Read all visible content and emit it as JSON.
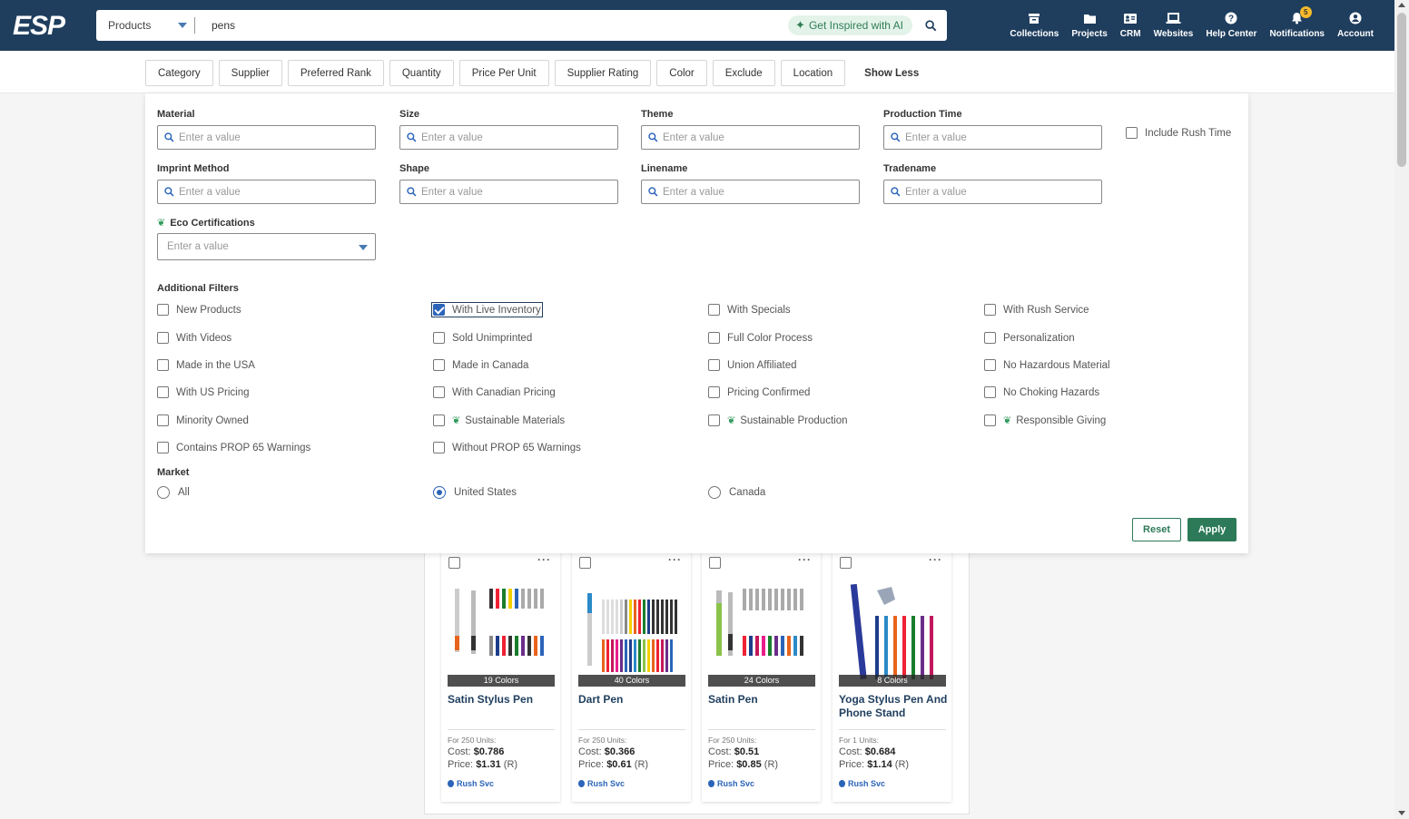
{
  "header": {
    "logo": "ESP",
    "search_scope": "Products",
    "search_value": "pens",
    "ai_label": "Get Inspired with AI",
    "nav": [
      {
        "label": "Collections",
        "icon": "collections-icon"
      },
      {
        "label": "Projects",
        "icon": "folder-icon"
      },
      {
        "label": "CRM",
        "icon": "contact-card-icon"
      },
      {
        "label": "Websites",
        "icon": "laptop-icon"
      },
      {
        "label": "Help Center",
        "icon": "help-icon"
      },
      {
        "label": "Notifications",
        "icon": "bell-icon",
        "badge": "5"
      },
      {
        "label": "Account",
        "icon": "account-icon"
      }
    ]
  },
  "filter_tabs": [
    "Category",
    "Supplier",
    "Preferred Rank",
    "Quantity",
    "Price Per Unit",
    "Supplier Rating",
    "Color",
    "Exclude",
    "Location"
  ],
  "show_less": "Show Less",
  "fields": {
    "material": "Material",
    "size": "Size",
    "theme": "Theme",
    "production_time": "Production Time",
    "imprint_method": "Imprint Method",
    "shape": "Shape",
    "linename": "Linename",
    "tradename": "Tradename",
    "eco_certifications": "Eco Certifications",
    "placeholder": "Enter a value",
    "include_rush": "Include Rush Time"
  },
  "additional_filters": {
    "title": "Additional Filters",
    "col1": [
      "New Products",
      "With Videos",
      "Made in the USA",
      "With US Pricing",
      "Minority Owned",
      "Contains PROP 65 Warnings"
    ],
    "col2": [
      "With Live Inventory",
      "Sold Unimprinted",
      "Made in Canada",
      "With Canadian Pricing",
      "Sustainable Materials",
      "Without PROP 65 Warnings"
    ],
    "col3": [
      "With Specials",
      "Full Color Process",
      "Union Affiliated",
      "Pricing Confirmed",
      "Sustainable Production"
    ],
    "col4": [
      "With Rush Service",
      "Personalization",
      "No Hazardous Material",
      "No Choking Hazards",
      "Responsible Giving"
    ]
  },
  "market": {
    "title": "Market",
    "options": [
      "All",
      "United States",
      "Canada"
    ],
    "selected": "United States"
  },
  "buttons": {
    "reset": "Reset",
    "apply": "Apply"
  },
  "products": [
    {
      "name": "Satin Stylus Pen",
      "colors": "19 Colors",
      "units": "For 250 Units:",
      "cost_label": "Cost:",
      "cost": "$0.786",
      "price_label": "Price:",
      "price": "$1.31",
      "price_suffix": "(R)",
      "rush": "Rush Svc"
    },
    {
      "name": "Dart Pen",
      "colors": "40 Colors",
      "units": "For 250 Units:",
      "cost_label": "Cost:",
      "cost": "$0.366",
      "price_label": "Price:",
      "price": "$0.61",
      "price_suffix": "(R)",
      "rush": "Rush Svc"
    },
    {
      "name": "Satin Pen",
      "colors": "24 Colors",
      "units": "For 250 Units:",
      "cost_label": "Cost:",
      "cost": "$0.51",
      "price_label": "Price:",
      "price": "$0.85",
      "price_suffix": "(R)",
      "rush": "Rush Svc"
    },
    {
      "name": "Yoga Stylus Pen And Phone Stand",
      "colors": "8 Colors",
      "units": "For 1 Units:",
      "cost_label": "Cost:",
      "cost": "$0.684",
      "price_label": "Price:",
      "price": "$1.14",
      "price_suffix": "(R)",
      "rush": "Rush Svc"
    }
  ]
}
